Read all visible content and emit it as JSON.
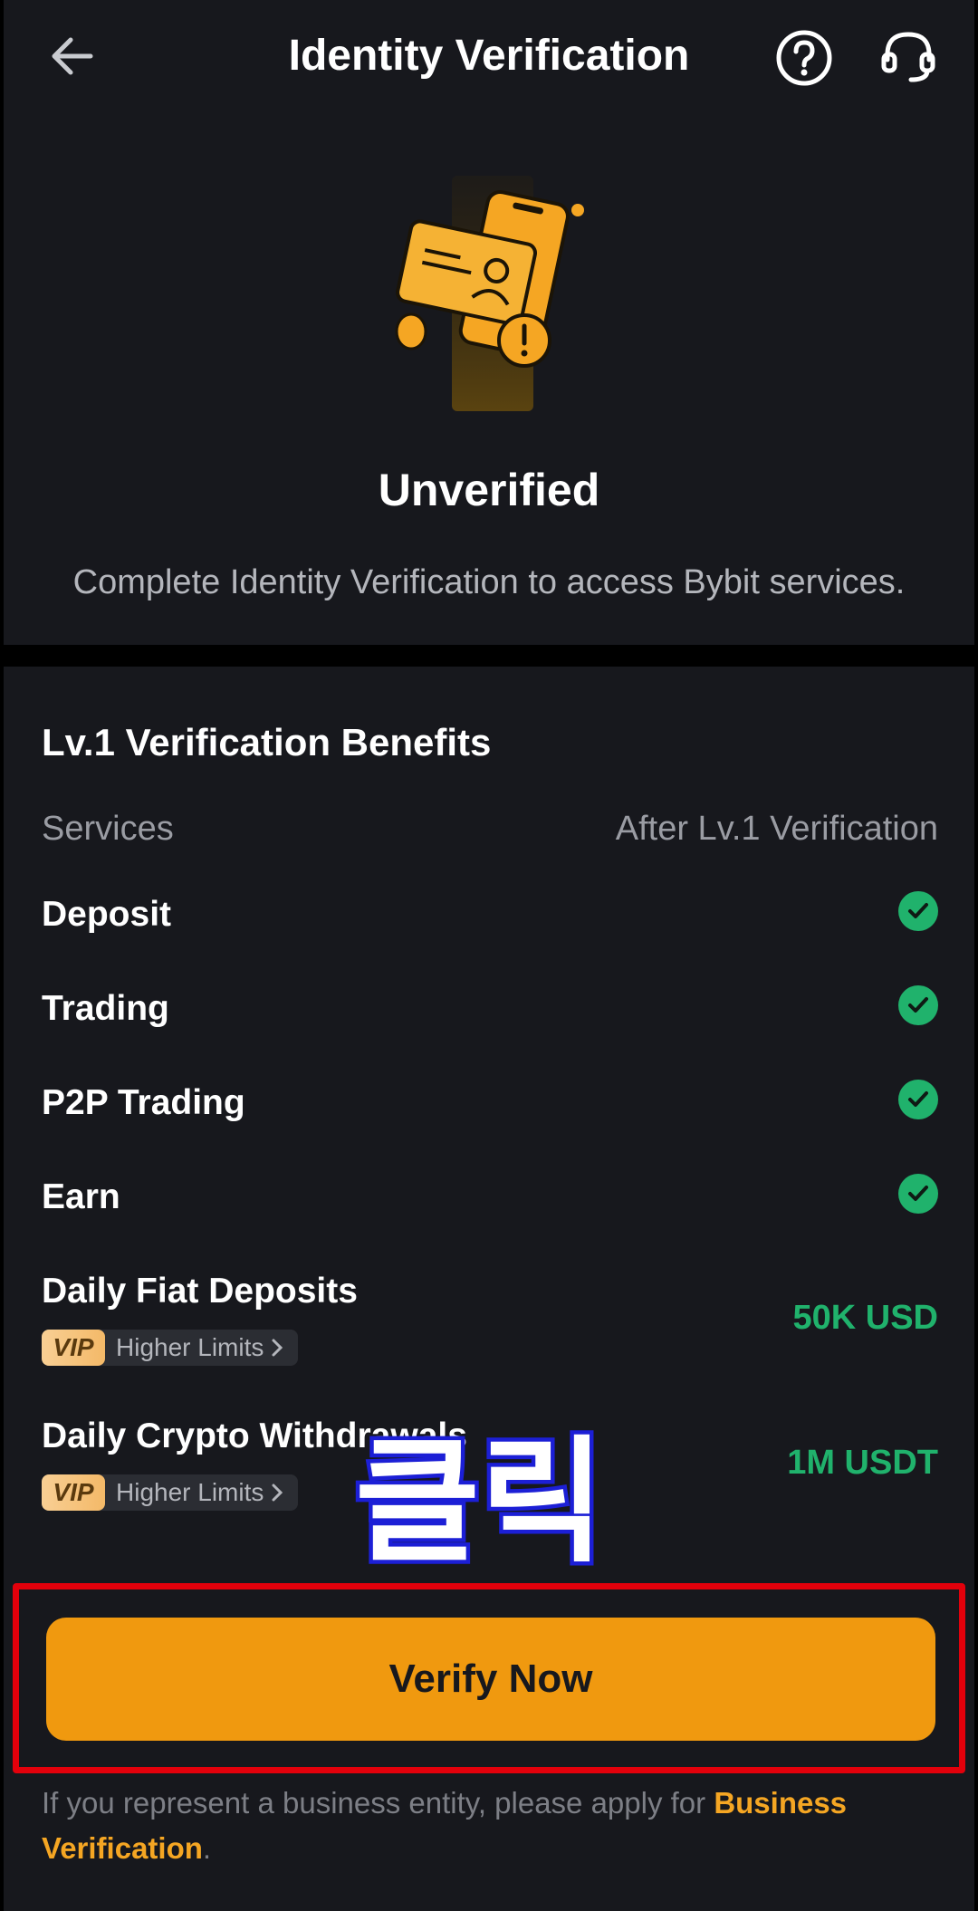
{
  "header": {
    "title": "Identity Verification",
    "back_icon": "arrow-left-icon",
    "help_icon": "question-circle-icon",
    "support_icon": "headset-icon"
  },
  "status": {
    "title": "Unverified",
    "description": "Complete Identity Verification to access Bybit services.",
    "illustration": "id-card-phone-illustration"
  },
  "benefits": {
    "title": "Lv.1 Verification Benefits",
    "col_services": "Services",
    "col_after": "After Lv.1 Verification",
    "items": [
      {
        "label": "Deposit"
      },
      {
        "label": "Trading"
      },
      {
        "label": "P2P Trading"
      },
      {
        "label": "Earn"
      }
    ],
    "limits": [
      {
        "label": "Daily Fiat Deposits",
        "value": "50K USD",
        "vip": "VIP",
        "vip_text": "Higher Limits"
      },
      {
        "label": "Daily Crypto Withdrawals",
        "value": "1M USDT",
        "vip": "VIP",
        "vip_text": "Higher Limits"
      }
    ]
  },
  "action": {
    "verify_label": "Verify Now"
  },
  "overlay": {
    "text": "클릭"
  },
  "footer": {
    "note_prefix": "If you represent a business entity, please apply for ",
    "note_link": "Business Verification",
    "note_suffix": "."
  },
  "colors": {
    "accent": "#f0990f",
    "success": "#20b26c",
    "background": "#17181d",
    "highlight_box": "#e3000b"
  }
}
